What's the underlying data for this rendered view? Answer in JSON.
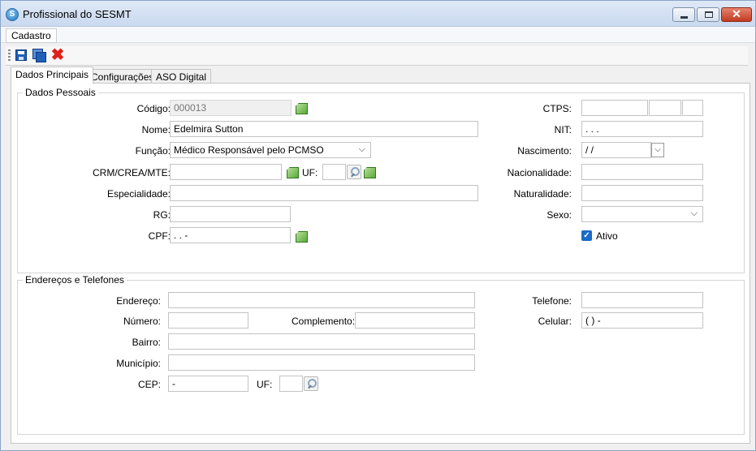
{
  "window": {
    "title": "Profissional do SESMT",
    "app_icon": "app-logo-icon",
    "controls": {
      "minimize": "minimize-icon",
      "maximize": "maximize-icon",
      "close": "close-icon"
    }
  },
  "menu": {
    "items": [
      "Cadastro"
    ]
  },
  "toolbar": {
    "buttons": [
      {
        "name": "save",
        "icon": "save-icon"
      },
      {
        "name": "save-as",
        "icon": "save-multiple-icon"
      },
      {
        "name": "cancel",
        "icon": "red-x-icon"
      }
    ]
  },
  "tabs": [
    "Dados Principais",
    "Configurações",
    "ASO Digital"
  ],
  "personal": {
    "group_title": "Dados Pessoais",
    "codigo_label": "Código:",
    "codigo_value": "000013",
    "nome_label": "Nome:",
    "nome_value": "Edelmira Sutton",
    "funcao_label": "Função:",
    "funcao_value": "Médico Responsável pelo PCMSO",
    "crm_label": "CRM/CREA/MTE:",
    "crm_value": "",
    "uf_label": "UF:",
    "uf_value": "",
    "especialidade_label": "Especialidade:",
    "especialidade_value": "",
    "rg_label": "RG:",
    "rg_value": "",
    "cpf_label": "CPF:",
    "cpf_value": ". . -",
    "ctps_label": "CTPS:",
    "nit_label": "NIT:",
    "nit_value": ". . .",
    "nascimento_label": "Nascimento:",
    "nascimento_value": "/ /",
    "nacionalidade_label": "Nacionalidade:",
    "nacionalidade_value": "",
    "naturalidade_label": "Naturalidade:",
    "naturalidade_value": "",
    "sexo_label": "Sexo:",
    "sexo_value": "",
    "ativo_label": "Ativo",
    "ativo_checked": true
  },
  "address": {
    "group_title": "Endereços e Telefones",
    "endereco_label": "Endereço:",
    "endereco_value": "",
    "numero_label": "Número:",
    "numero_value": "",
    "complemento_label": "Complemento:",
    "complemento_value": "",
    "bairro_label": "Bairro:",
    "bairro_value": "",
    "municipio_label": "Município:",
    "municipio_value": "",
    "cep_label": "CEP:",
    "cep_value": "-",
    "uf_label": "UF:",
    "uf_value": "",
    "telefone_label": "Telefone:",
    "telefone_value": "",
    "celular_label": "Celular:",
    "celular_value": "( ) -"
  }
}
